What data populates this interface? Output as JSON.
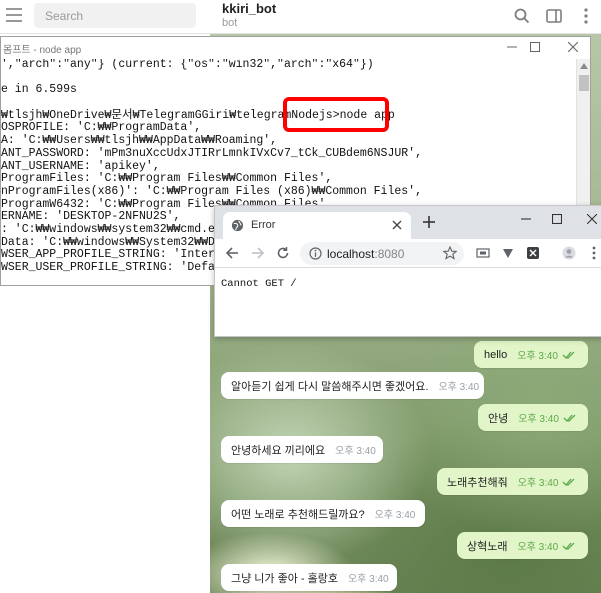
{
  "telegram": {
    "search_placeholder": "Search",
    "chat_title": "kkiri_bot",
    "chat_subtitle": "bot",
    "action_icons": [
      "search-icon",
      "sidebar-toggle-icon",
      "more-vertical-icon"
    ],
    "messages": [
      {
        "dir": "out",
        "text": "hello",
        "time": "오후 3:40",
        "read": true
      },
      {
        "dir": "in",
        "text": "알아듣기 쉽게 다시 말씀해주시면 좋겠어요.",
        "time": "오후 3:40"
      },
      {
        "dir": "out",
        "text": "안녕",
        "time": "오후 3:40",
        "read": true
      },
      {
        "dir": "in",
        "text": "안녕하세요 끼리에요",
        "time": "오후 3:40"
      },
      {
        "dir": "out",
        "text": "노래추천해줘",
        "time": "오후 3:40",
        "read": true
      },
      {
        "dir": "in",
        "text": "어떤 노래로 추천해드릴까요?",
        "time": "오후 3:40"
      },
      {
        "dir": "out",
        "text": "상혁노래",
        "time": "오후 3:40",
        "read": true
      },
      {
        "dir": "in",
        "text": "그냥 니가 좋아 - 홀랑호",
        "time": "오후 3:40"
      }
    ]
  },
  "console": {
    "title": "몸프트 - node  app",
    "lines": [
      "',\"arch\":\"any\"} (current: {\"os\":\"win32\",\"arch\":\"x64\"})",
      "",
      "e in 6.599s",
      "",
      "₩tlsjh₩OneDrive₩문서₩TelegramGGiri₩telegramNodejs>node app",
      "OSPROFILE: 'C:₩₩ProgramData',",
      "A: 'C:₩₩Users₩₩tlsjh₩₩AppData₩₩Roaming',",
      "ANT_PASSWORD: 'mPm3nuXccUdxJTIRrLmnkIVxCv7_tCk_CUBdem6NSJUR',",
      "ANT_USERNAME: 'apikey',",
      "ProgramFiles: 'C:₩₩Program Files₩₩Common Files',",
      "nProgramFiles(x86)': 'C:₩₩Program Files (x86)₩₩Common Files',",
      "ProgramW6432: 'C:₩₩Program Files₩₩Common Files',",
      "ERNAME: 'DESKTOP-2NFNU2S',",
      ": 'C:₩₩windows₩₩system32₩₩cmd.exe',",
      "Data: 'C:₩₩windows₩₩System32₩₩DriverData',",
      "WSER_APP_PROFILE_STRING: 'Internet Explorer',",
      "WSER_USER_PROFILE_STRING: 'Default',"
    ]
  },
  "browser": {
    "tab_title": "Error",
    "url_host": "localhost",
    "url_port": ":8080",
    "page_text": "Cannot GET /"
  },
  "colors": {
    "highlight": "#ff0000",
    "outgoing_bubble": "#e1f5c8",
    "incoming_bubble": "#ffffff",
    "read_ticks": "#5ea94b"
  }
}
